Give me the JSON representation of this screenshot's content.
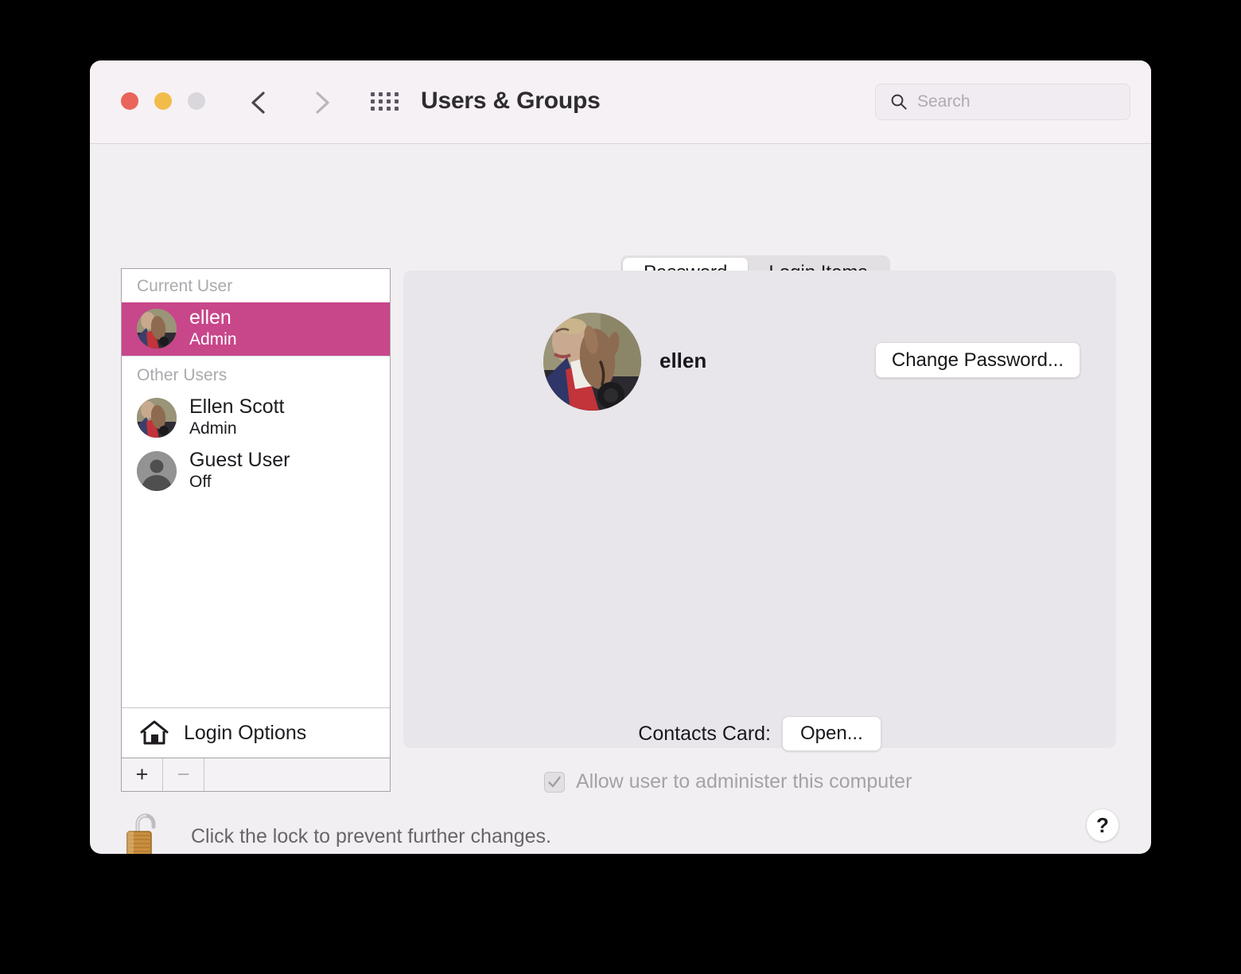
{
  "window": {
    "title": "Users & Groups",
    "traffic_lights": [
      "close-red",
      "minimize-yellow",
      "zoom-gray"
    ],
    "back_label": "Back",
    "forward_label": "Forward",
    "grid_label": "Show All",
    "colors": {
      "accent_selected": "#C8468A",
      "titlebar": "#F6F1F5",
      "window_bg": "#F2EFF2",
      "panel_bg": "#E8E6EA",
      "traffic_red": "#E9655B",
      "traffic_yellow": "#F2BC4B",
      "traffic_gray": "#D9D7DC"
    }
  },
  "search": {
    "placeholder": "Search",
    "value": "",
    "icon": "search-icon"
  },
  "sidebar": {
    "group_current": "Current User",
    "group_other": "Other Users",
    "current_user": {
      "name": "ellen",
      "role": "Admin",
      "avatar": "photo-avatar",
      "selected": true
    },
    "other_users": [
      {
        "name": "Ellen Scott",
        "role": "Admin",
        "avatar": "photo-avatar",
        "selected": false
      },
      {
        "name": "Guest User",
        "role": "Off",
        "avatar": "generic-person-icon",
        "selected": false
      }
    ],
    "login_options": {
      "label": "Login Options",
      "icon": "home-icon"
    },
    "add_button": "+",
    "remove_button": "−"
  },
  "main": {
    "tabs": [
      {
        "label": "Password",
        "active": true
      },
      {
        "label": "Login Items",
        "active": false
      }
    ],
    "account_name": "ellen",
    "avatar": "photo-avatar",
    "change_password_button": "Change Password...",
    "contacts_card_label": "Contacts Card:",
    "contacts_card_button": "Open...",
    "admin_checkbox": {
      "label": "Allow user to administer this computer",
      "checked": true,
      "enabled": false
    }
  },
  "footer": {
    "lock_icon": "unlocked-padlock-icon",
    "lock_text": "Click the lock to prevent further changes.",
    "help_button": "?"
  }
}
